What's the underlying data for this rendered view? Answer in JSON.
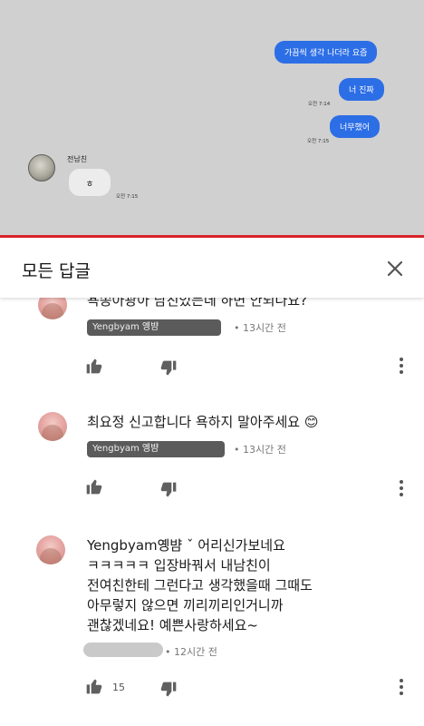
{
  "video": {
    "messages_out": [
      {
        "text": "가끔씩 생각 나더라 요즘",
        "time": "오전 7:14"
      },
      {
        "text": "너 진짜",
        "time": "오전 7:14"
      },
      {
        "text": "너무했어",
        "time": "오전 7:15"
      }
    ],
    "sender_name": "전남친",
    "message_in": {
      "text": "ㅎ",
      "time": "오전 7:15"
    }
  },
  "replies": {
    "title": "모든 답글"
  },
  "comments": [
    {
      "text": "욕쫑아광아 남친있는데 하면 안되나요?",
      "author": "Yengbyam 옝뱜",
      "age": "• 13시간 전"
    },
    {
      "text": "최요정 신고합니다 욕하지 말아주세요 😊",
      "author": "Yengbyam 옝뱜",
      "age": "• 13시간 전"
    },
    {
      "author_inline": "Yengbyam옝뱜 ˇ",
      "lines": [
        "어리신가보네요",
        "ㅋㅋㅋㅋㅋ 입장바꿔서 내남친이",
        "전여친한테 그런다고 생각했을때 그때도",
        "아무렇지 않으면 끼리끼리인거니까",
        "괜찮겠네요! 예쁜사랑하세요~"
      ],
      "age": "• 12시간 전",
      "likes": "15"
    }
  ],
  "colors": {
    "bubble_out": "#2c6ee6",
    "progress": "#d9232b",
    "video_bg": "#d0d0d0"
  }
}
